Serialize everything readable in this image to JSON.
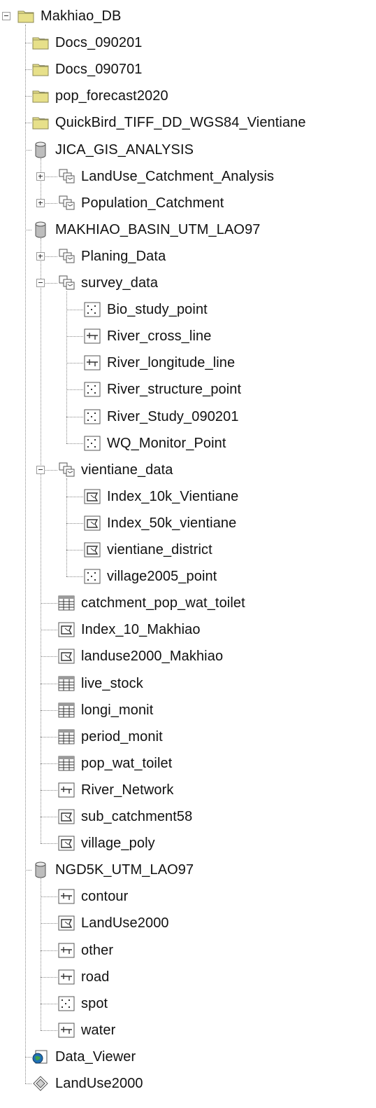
{
  "tree": {
    "nodes": [
      {
        "label": "Makhiao_DB",
        "depth": 0,
        "icon": "folder-icon",
        "toggle": "minus"
      },
      {
        "label": "Docs_090201",
        "depth": 1,
        "icon": "folder-icon",
        "toggle": "plus"
      },
      {
        "label": "Docs_090701",
        "depth": 1,
        "icon": "folder-icon",
        "toggle": "plus"
      },
      {
        "label": "pop_forecast2020",
        "depth": 1,
        "icon": "folder-icon",
        "toggle": "plus"
      },
      {
        "label": "QuickBird_TIFF_DD_WGS84_Vientiane",
        "depth": 1,
        "icon": "folder-icon",
        "toggle": "plus"
      },
      {
        "label": "JICA_GIS_ANALYSIS",
        "depth": 1,
        "icon": "database-icon",
        "toggle": "minus"
      },
      {
        "label": "LandUse_Catchment_Analysis",
        "depth": 2,
        "icon": "feature-dataset-icon",
        "toggle": "plus"
      },
      {
        "label": "Population_Catchment",
        "depth": 2,
        "icon": "feature-dataset-icon",
        "toggle": "plus"
      },
      {
        "label": "MAKHIAO_BASIN_UTM_LAO97",
        "depth": 1,
        "icon": "database-icon",
        "toggle": "minus"
      },
      {
        "label": "Planing_Data",
        "depth": 2,
        "icon": "feature-dataset-icon",
        "toggle": "plus"
      },
      {
        "label": "survey_data",
        "depth": 2,
        "icon": "feature-dataset-icon",
        "toggle": "minus"
      },
      {
        "label": "Bio_study_point",
        "depth": 3,
        "icon": "point-feature-class-icon",
        "toggle": ""
      },
      {
        "label": "River_cross_line",
        "depth": 3,
        "icon": "line-feature-class-icon",
        "toggle": ""
      },
      {
        "label": "River_longitude_line",
        "depth": 3,
        "icon": "line-feature-class-icon",
        "toggle": ""
      },
      {
        "label": "River_structure_point",
        "depth": 3,
        "icon": "point-feature-class-icon",
        "toggle": ""
      },
      {
        "label": "River_Study_090201",
        "depth": 3,
        "icon": "point-feature-class-icon",
        "toggle": ""
      },
      {
        "label": "WQ_Monitor_Point",
        "depth": 3,
        "icon": "point-feature-class-icon",
        "toggle": ""
      },
      {
        "label": "vientiane_data",
        "depth": 2,
        "icon": "feature-dataset-icon",
        "toggle": "minus"
      },
      {
        "label": "Index_10k_Vientiane",
        "depth": 3,
        "icon": "polygon-feature-class-icon",
        "toggle": ""
      },
      {
        "label": "Index_50k_vientiane",
        "depth": 3,
        "icon": "polygon-feature-class-icon",
        "toggle": ""
      },
      {
        "label": "vientiane_district",
        "depth": 3,
        "icon": "polygon-feature-class-icon",
        "toggle": ""
      },
      {
        "label": "village2005_point",
        "depth": 3,
        "icon": "point-feature-class-icon",
        "toggle": ""
      },
      {
        "label": "catchment_pop_wat_toilet",
        "depth": 2,
        "icon": "table-icon",
        "toggle": ""
      },
      {
        "label": "Index_10_Makhiao",
        "depth": 2,
        "icon": "polygon-feature-class-icon",
        "toggle": ""
      },
      {
        "label": "landuse2000_Makhiao",
        "depth": 2,
        "icon": "polygon-feature-class-icon",
        "toggle": ""
      },
      {
        "label": "live_stock",
        "depth": 2,
        "icon": "table-icon",
        "toggle": ""
      },
      {
        "label": "longi_monit",
        "depth": 2,
        "icon": "table-icon",
        "toggle": ""
      },
      {
        "label": "period_monit",
        "depth": 2,
        "icon": "table-icon",
        "toggle": ""
      },
      {
        "label": "pop_wat_toilet",
        "depth": 2,
        "icon": "table-icon",
        "toggle": ""
      },
      {
        "label": "River_Network",
        "depth": 2,
        "icon": "line-feature-class-icon",
        "toggle": ""
      },
      {
        "label": "sub_catchment58",
        "depth": 2,
        "icon": "polygon-feature-class-icon",
        "toggle": ""
      },
      {
        "label": "village_poly",
        "depth": 2,
        "icon": "polygon-feature-class-icon",
        "toggle": ""
      },
      {
        "label": "NGD5K_UTM_LAO97",
        "depth": 1,
        "icon": "database-icon",
        "toggle": "minus"
      },
      {
        "label": "contour",
        "depth": 2,
        "icon": "line-feature-class-icon",
        "toggle": ""
      },
      {
        "label": "LandUse2000",
        "depth": 2,
        "icon": "polygon-feature-class-icon",
        "toggle": ""
      },
      {
        "label": "other",
        "depth": 2,
        "icon": "line-feature-class-icon",
        "toggle": ""
      },
      {
        "label": "road",
        "depth": 2,
        "icon": "line-feature-class-icon",
        "toggle": ""
      },
      {
        "label": "spot",
        "depth": 2,
        "icon": "point-feature-class-icon",
        "toggle": ""
      },
      {
        "label": "water",
        "depth": 2,
        "icon": "line-feature-class-icon",
        "toggle": ""
      },
      {
        "label": "Data_Viewer",
        "depth": 1,
        "icon": "map-document-icon",
        "toggle": ""
      },
      {
        "label": "LandUse2000",
        "depth": 1,
        "icon": "layer-file-icon",
        "toggle": ""
      }
    ]
  },
  "colors": {
    "folder": "#e7e08a",
    "folder_border": "#8c8a55",
    "database": "#bdbdbd",
    "icon_stroke": "#555555",
    "connector": "#8a8a8a"
  }
}
